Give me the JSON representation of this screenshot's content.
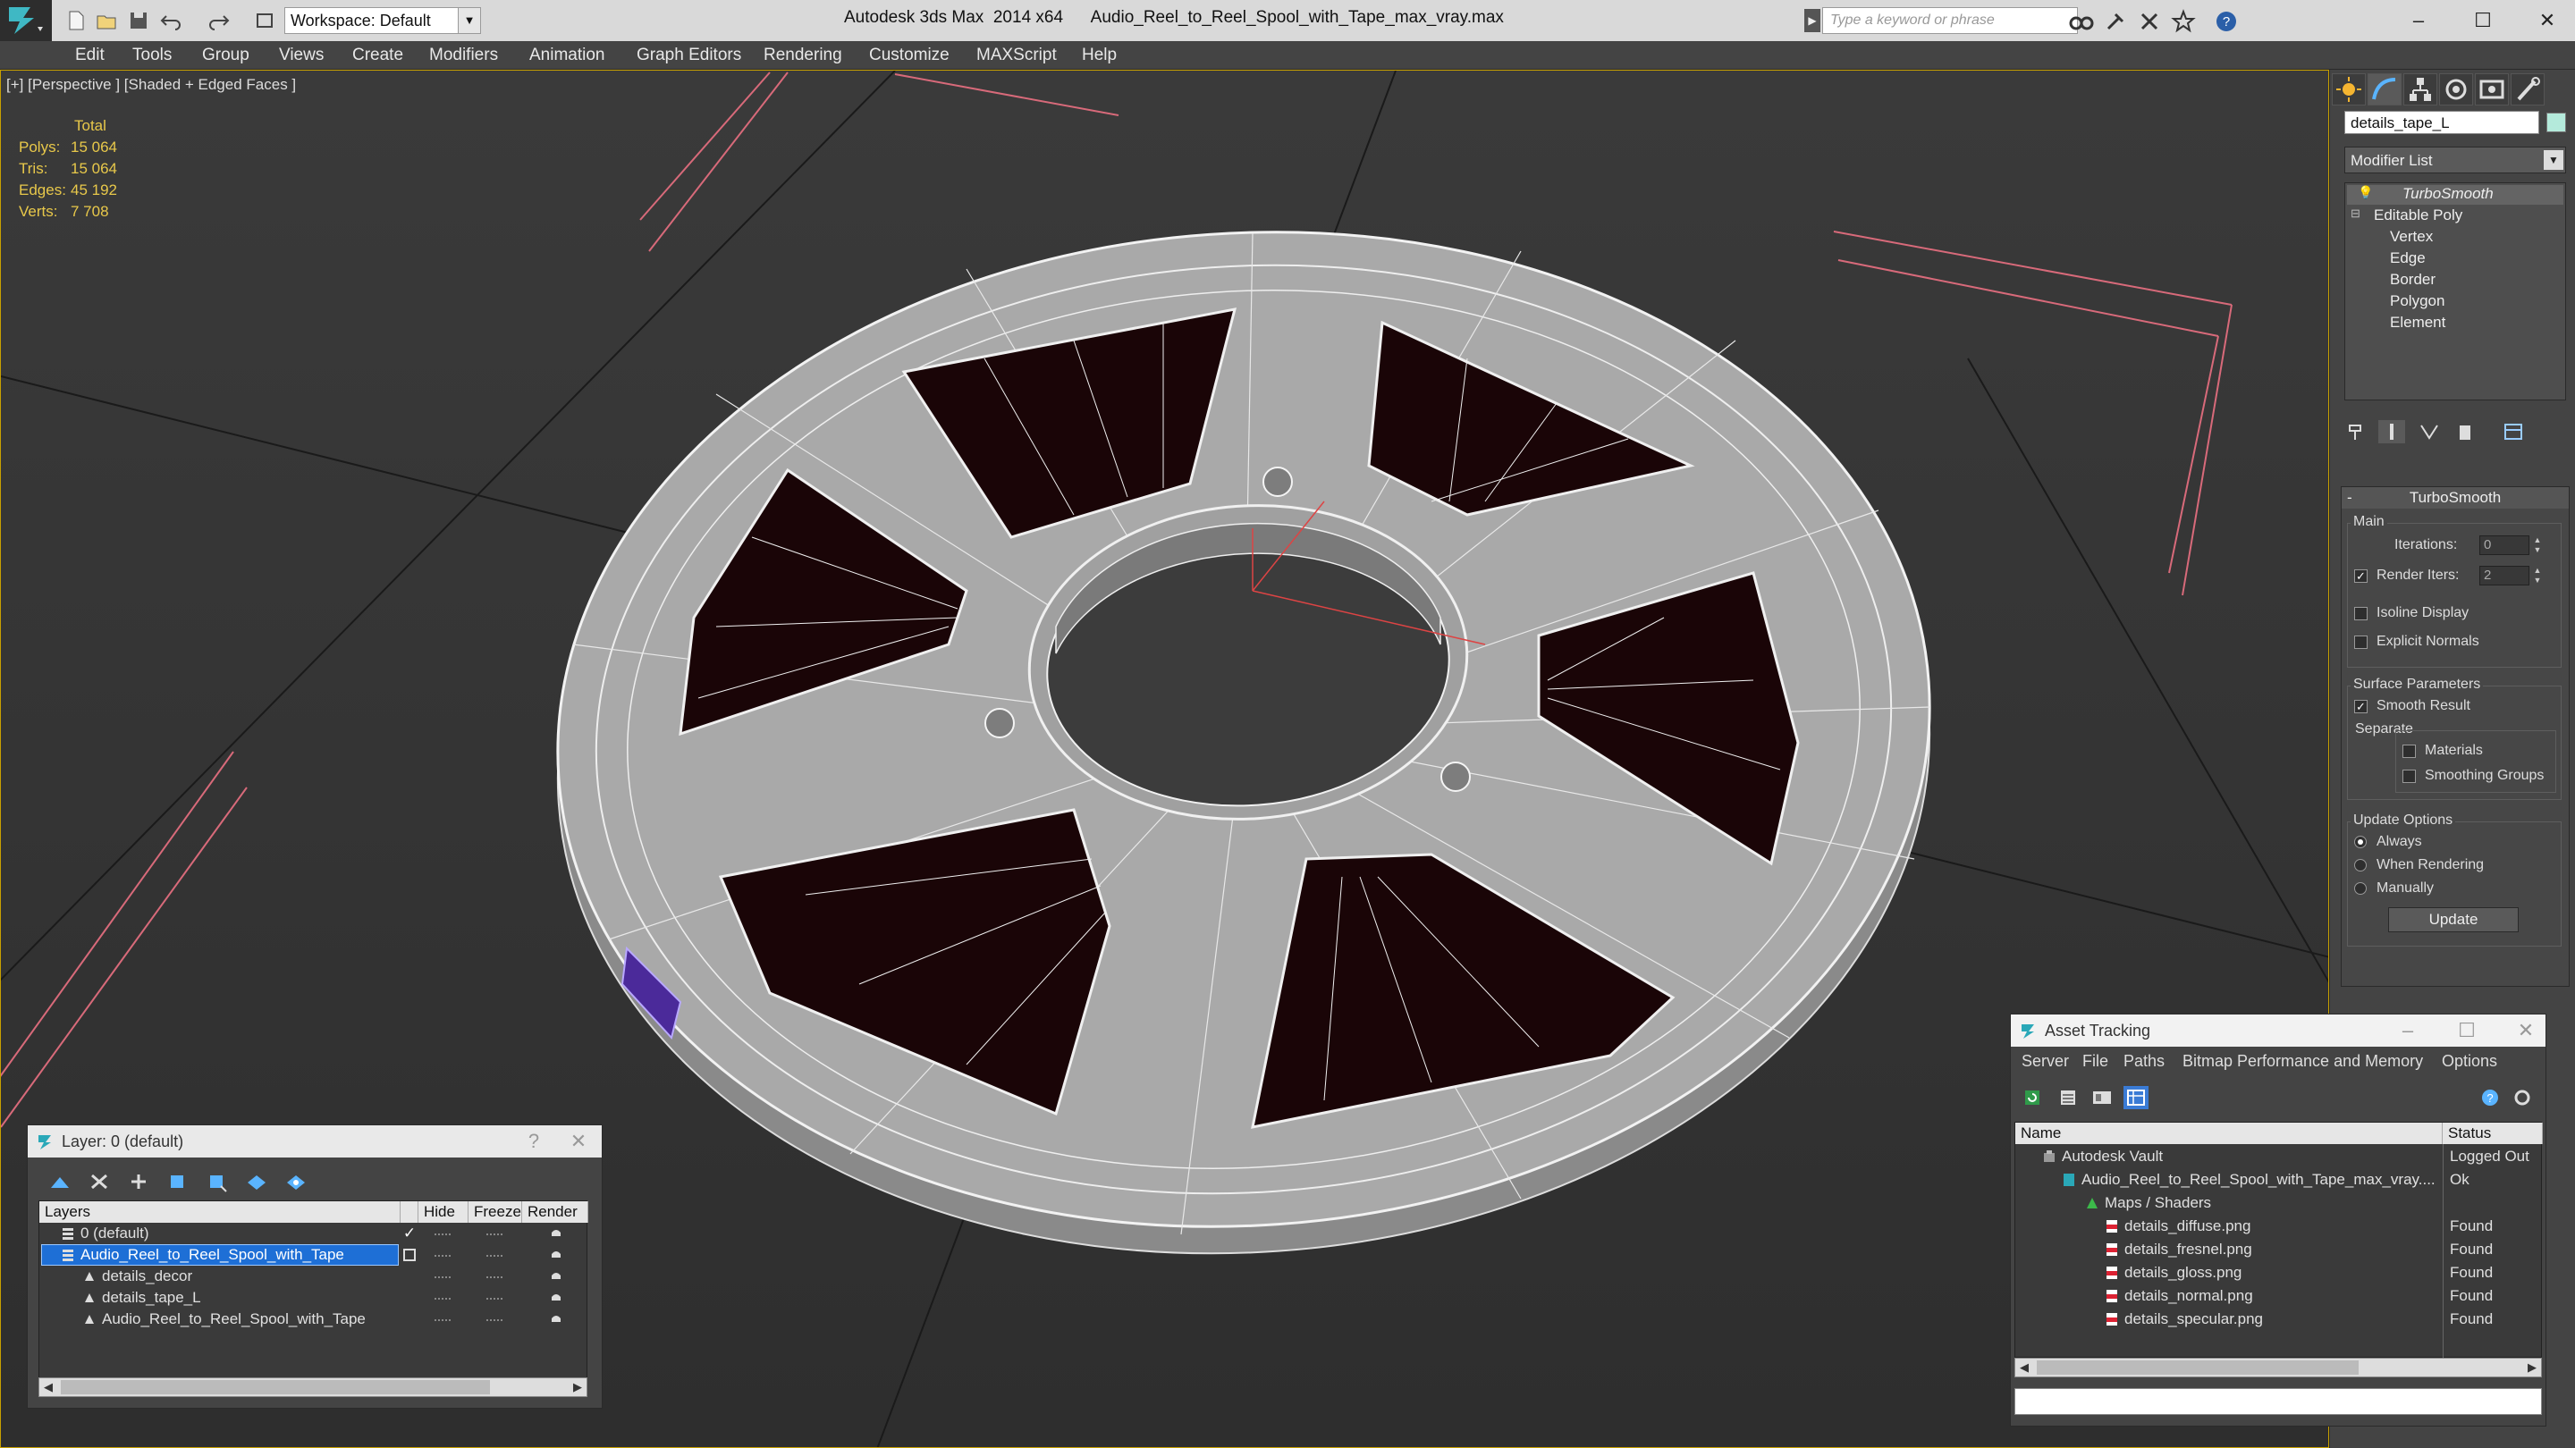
{
  "app": {
    "title_app": "Autodesk 3ds Max  2014 x64",
    "title_file": "Audio_Reel_to_Reel_Spool_with_Tape_max_vray.max",
    "workspace": "Workspace: Default",
    "search_placeholder": "Type a keyword or phrase"
  },
  "menu": [
    "Edit",
    "Tools",
    "Group",
    "Views",
    "Create",
    "Modifiers",
    "Animation",
    "Graph Editors",
    "Rendering",
    "Customize",
    "MAXScript",
    "Help"
  ],
  "viewport": {
    "label": "[+] [Perspective ] [Shaded + Edged Faces ]",
    "stats": {
      "total_label": "Total",
      "rows": [
        {
          "label": "Polys:",
          "value": "15 064"
        },
        {
          "label": "Tris:",
          "value": "15 064"
        },
        {
          "label": "Edges:",
          "value": "45 192"
        },
        {
          "label": "Verts:",
          "value": "7 708"
        }
      ]
    }
  },
  "command_panel": {
    "object_name": "details_tape_L",
    "object_color": "#b4eadb",
    "modifier_list": "Modifier List",
    "stack": {
      "turbosmooth": "TurboSmooth",
      "editable_poly": "Editable Poly",
      "subobjects": [
        "Vertex",
        "Edge",
        "Border",
        "Polygon",
        "Element"
      ]
    },
    "turbosmooth": {
      "title": "TurboSmooth",
      "main_label": "Main",
      "iterations_label": "Iterations:",
      "iterations_value": "0",
      "render_iters_label": "Render Iters:",
      "render_iters_value": "2",
      "render_iters_checked": true,
      "isoline_label": "Isoline Display",
      "explicit_normals_label": "Explicit Normals",
      "surface_params_label": "Surface Parameters",
      "smooth_result_label": "Smooth Result",
      "smooth_result_checked": true,
      "separate_label": "Separate",
      "materials_label": "Materials",
      "smoothing_groups_label": "Smoothing Groups",
      "update_options_label": "Update Options",
      "always_label": "Always",
      "when_rendering_label": "When Rendering",
      "manually_label": "Manually",
      "selected_update_option": "Always",
      "update_button": "Update"
    }
  },
  "layer_panel": {
    "title": "Layer: 0 (default)",
    "columns": {
      "layers": "Layers",
      "hide": "Hide",
      "freeze": "Freeze",
      "render": "Render"
    },
    "rows": [
      {
        "name": "0 (default)",
        "checked": true
      },
      {
        "name": "Audio_Reel_to_Reel_Spool_with_Tape",
        "selected": true
      },
      {
        "name": "details_decor"
      },
      {
        "name": "details_tape_L"
      },
      {
        "name": "Audio_Reel_to_Reel_Spool_with_Tape"
      }
    ]
  },
  "asset_tracking": {
    "title": "Asset Tracking",
    "menu": [
      "Server",
      "File",
      "Paths",
      "Bitmap Performance and Memory",
      "Options"
    ],
    "columns": {
      "name": "Name",
      "status": "Status"
    },
    "rows": [
      {
        "name": "Autodesk Vault",
        "status": "Logged Out"
      },
      {
        "name": "Audio_Reel_to_Reel_Spool_with_Tape_max_vray....",
        "status": "Ok"
      },
      {
        "name": "Maps / Shaders",
        "status": ""
      },
      {
        "name": "details_diffuse.png",
        "status": "Found"
      },
      {
        "name": "details_fresnel.png",
        "status": "Found"
      },
      {
        "name": "details_gloss.png",
        "status": "Found"
      },
      {
        "name": "details_normal.png",
        "status": "Found"
      },
      {
        "name": "details_specular.png",
        "status": "Found"
      }
    ]
  }
}
